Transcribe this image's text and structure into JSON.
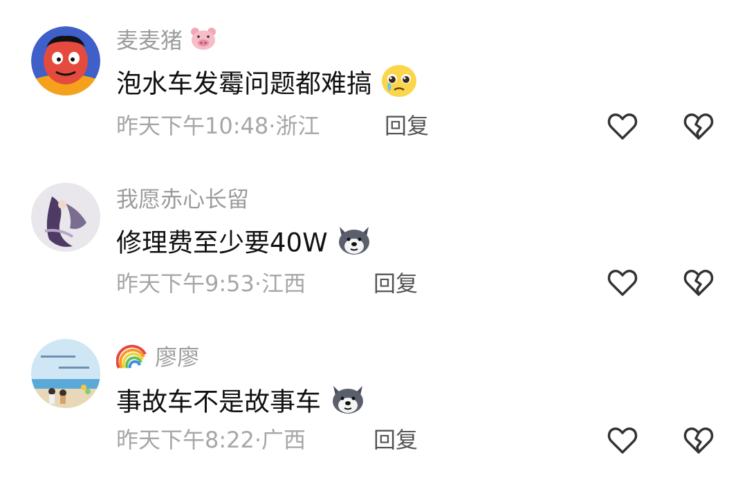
{
  "comments": [
    {
      "username": "麦麦猪",
      "username_emoji": "pig-face",
      "content": "泡水车发霉问题都难搞",
      "content_emoji": "pleading-face",
      "time": "昨天下午10:48",
      "separator": "·",
      "location": "浙江",
      "reply_label": "回复"
    },
    {
      "username": "我愿赤心长留",
      "content": "修理费至少要40W",
      "content_emoji": "dog-face",
      "time": "昨天下午9:53",
      "separator": "·",
      "location": "江西",
      "reply_label": "回复"
    },
    {
      "username_emoji": "rainbow",
      "username": "廖廖",
      "content": "事故车不是故事车",
      "content_emoji": "dog-face",
      "time": "昨天下午8:22",
      "separator": "·",
      "location": "广西",
      "reply_label": "回复"
    }
  ],
  "icons": {
    "like": "heart-outline-icon",
    "dislike": "broken-heart-outline-icon"
  },
  "colors": {
    "username": "#9c9c9c",
    "content": "#111111",
    "meta": "#a6a6a6",
    "reply": "#555555",
    "icon": "#333333"
  }
}
